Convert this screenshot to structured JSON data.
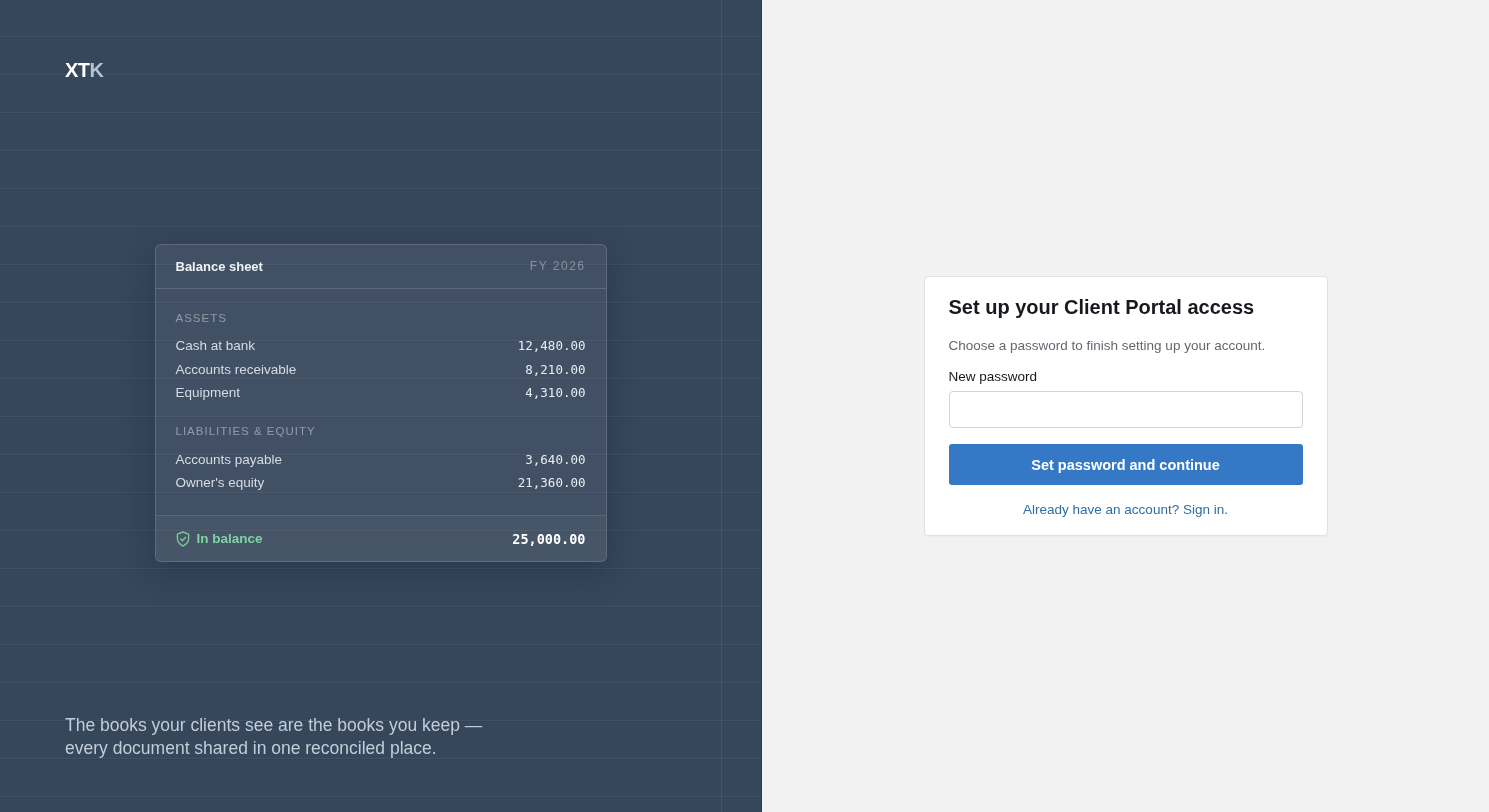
{
  "brand": {
    "logo": {
      "main": "XT",
      "accent": "K"
    },
    "tagline": "The books your clients see are the books you keep — every document shared in one reconciled place."
  },
  "balance_sheet": {
    "title": "Balance sheet",
    "period": "FY 2026",
    "sections": [
      {
        "heading": "ASSETS",
        "rows": [
          {
            "label": "Cash at bank",
            "amount": "12,480.00"
          },
          {
            "label": "Accounts receivable",
            "amount": "8,210.00"
          },
          {
            "label": "Equipment",
            "amount": "4,310.00"
          }
        ]
      },
      {
        "heading": "LIABILITIES & EQUITY",
        "rows": [
          {
            "label": "Accounts payable",
            "amount": "3,640.00"
          },
          {
            "label": "Owner's equity",
            "amount": "21,360.00"
          }
        ]
      }
    ],
    "footer": {
      "status": "In balance",
      "total": "25,000.00"
    }
  },
  "setup_form": {
    "title": "Set up your Client Portal access",
    "subtitle": "Choose a password to finish setting up your account.",
    "fields": [
      {
        "label": "New password"
      }
    ],
    "submit": "Set password and continue",
    "sign_in_link": "Already have an account? Sign in."
  }
}
